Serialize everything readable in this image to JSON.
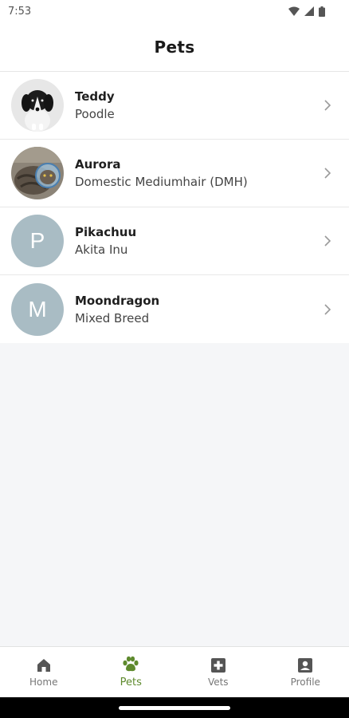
{
  "status_bar": {
    "time": "7:53"
  },
  "header": {
    "title": "Pets"
  },
  "pets": [
    {
      "name": "Teddy",
      "breed": "Poodle",
      "avatar_type": "photo-dog"
    },
    {
      "name": "Aurora",
      "breed": "Domestic Mediumhair (DMH)",
      "avatar_type": "photo-cat"
    },
    {
      "name": "Pikachuu",
      "breed": "Akita Inu",
      "avatar_letter": "P"
    },
    {
      "name": "Moondragon",
      "breed": "Mixed Breed",
      "avatar_letter": "M"
    }
  ],
  "bottom_nav": {
    "items": [
      {
        "label": "Home",
        "icon": "home-icon"
      },
      {
        "label": "Pets",
        "icon": "paw-icon",
        "active": true
      },
      {
        "label": "Vets",
        "icon": "medical-cross-icon"
      },
      {
        "label": "Profile",
        "icon": "profile-icon"
      }
    ]
  },
  "colors": {
    "accent": "#5e8a2d",
    "avatar_bg": "#a9bcc4",
    "background": "#f5f6f8"
  }
}
